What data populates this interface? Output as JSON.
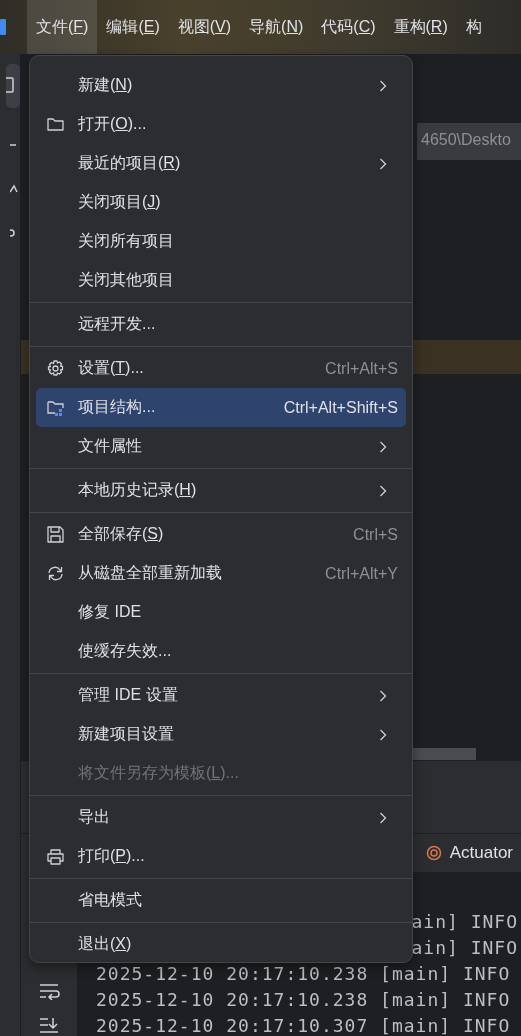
{
  "menu_bar": [
    {
      "text": "文件(",
      "mnemonic": "F",
      "text_end": ")",
      "selected": true
    },
    {
      "text": "编辑(",
      "mnemonic": "E",
      "text_end": ")",
      "selected": false
    },
    {
      "text": "视图(",
      "mnemonic": "V",
      "text_end": ")",
      "selected": false
    },
    {
      "text": "导航(",
      "mnemonic": "N",
      "text_end": ")",
      "selected": false
    },
    {
      "text": "代码(",
      "mnemonic": "C",
      "text_end": ")",
      "selected": false
    },
    {
      "text": "重构(",
      "mnemonic": "R",
      "text_end": ")",
      "selected": false
    },
    {
      "text": "构",
      "selected": false
    }
  ],
  "editor": {
    "path": "4650\\Deskto"
  },
  "bottom_panel": {
    "tab": "Actuator",
    "log_lines": [
      "ain] INFO",
      "ain] INFO",
      "2025-12-10 20:17:10.238 [main] INFO",
      "2025-12-10 20:17:10.238 [main] INFO",
      "2025-12-10 20:17:10.307 [main] INFO"
    ]
  },
  "file_menu": [
    [
      {
        "text": "新建(",
        "mnemonic": "N",
        "text_end": ")",
        "submenu": true,
        "selected": false,
        "disabled": false
      },
      {
        "text": "打开(",
        "mnemonic": "O",
        "text_end": ")...",
        "selected": false,
        "disabled": false
      },
      {
        "text": "最近的项目(",
        "mnemonic": "R",
        "text_end": ")",
        "submenu": true,
        "selected": false,
        "disabled": false
      },
      {
        "text": "关闭项目(",
        "mnemonic": "J",
        "text_end": ")",
        "selected": false,
        "disabled": false
      },
      {
        "text": "关闭所有项目",
        "selected": false,
        "disabled": false
      },
      {
        "text": "关闭其他项目",
        "selected": false,
        "disabled": false
      }
    ],
    [
      {
        "text": "远程开发...",
        "selected": false,
        "disabled": false
      }
    ],
    [
      {
        "text": "设置(",
        "mnemonic": "T",
        "text_end": ")...",
        "shortcut": "Ctrl+Alt+S",
        "selected": false,
        "disabled": false
      },
      {
        "text": "项目结构...",
        "shortcut": "Ctrl+Alt+Shift+S",
        "selected": true,
        "disabled": false
      },
      {
        "text": "文件属性",
        "submenu": true,
        "selected": false,
        "disabled": false
      }
    ],
    [
      {
        "text": "本地历史记录(",
        "mnemonic": "H",
        "text_end": ")",
        "submenu": true,
        "selected": false,
        "disabled": false
      }
    ],
    [
      {
        "text": "全部保存(",
        "mnemonic": "S",
        "text_end": ")",
        "shortcut": "Ctrl+S",
        "selected": false,
        "disabled": false
      },
      {
        "text": "从磁盘全部重新加载",
        "shortcut": "Ctrl+Alt+Y",
        "selected": false,
        "disabled": false
      },
      {
        "text": "修复 IDE",
        "selected": false,
        "disabled": false
      },
      {
        "text": "使缓存失效...",
        "selected": false,
        "disabled": false
      }
    ],
    [
      {
        "text": "管理 IDE 设置",
        "submenu": true,
        "selected": false,
        "disabled": false
      },
      {
        "text": "新建项目设置",
        "submenu": true,
        "selected": false,
        "disabled": false
      },
      {
        "text": "将文件另存为模板(",
        "mnemonic": "L",
        "text_end": ")...",
        "selected": false,
        "disabled": true
      }
    ],
    [
      {
        "text": "导出",
        "submenu": true,
        "selected": false,
        "disabled": false
      },
      {
        "text": "打印(",
        "mnemonic": "P",
        "text_end": ")...",
        "selected": false,
        "disabled": false
      }
    ],
    [
      {
        "text": "省电模式",
        "selected": false,
        "disabled": false
      }
    ],
    [
      {
        "text": "退出(",
        "mnemonic": "X",
        "text_end": ")",
        "selected": false,
        "disabled": false
      }
    ]
  ]
}
